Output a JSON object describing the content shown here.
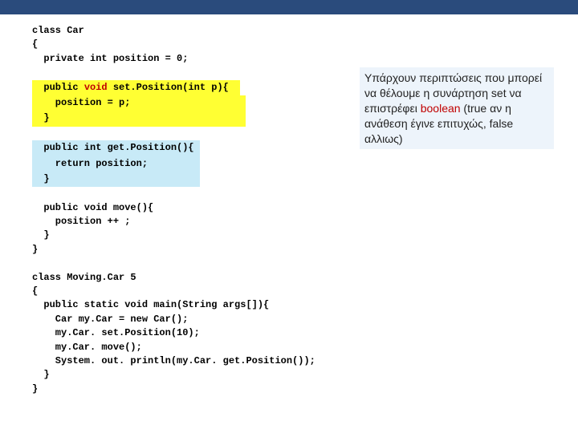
{
  "code": {
    "l1": "class Car",
    "l2": "{",
    "l3": "  private int position = 0;",
    "l4_pre": "  public ",
    "l4_void": "void",
    "l4_post": " set.Position(int p){  ",
    "l5": "    position = p;                    ",
    "l6": "  }                                  ",
    "l7": "  public int get.Position(){ ",
    "l8": "    return position;         ",
    "l9": "  }                          ",
    "l10": "  public void move(){",
    "l11": "    position ++ ;",
    "l12": "  }",
    "l13": "}",
    "l14": "class Moving.Car 5",
    "l15": "{",
    "l16": "  public static void main(String args[]){",
    "l17": "    Car my.Car = new Car();",
    "l18": "    my.Car. set.Position(10);",
    "l19": "    my.Car. move();",
    "l20": "    System. out. println(my.Car. get.Position());",
    "l21": "  }",
    "l22": "}"
  },
  "note": {
    "t1": "Υπάρχουν περιπτώσεις που μπορεί να θέλουμε η συνάρτηση set να επιστρέφει ",
    "boolean": "boolean",
    "t2": " (true αν η ανάθεση έγινε επιτυχώς, false αλλιως)"
  }
}
